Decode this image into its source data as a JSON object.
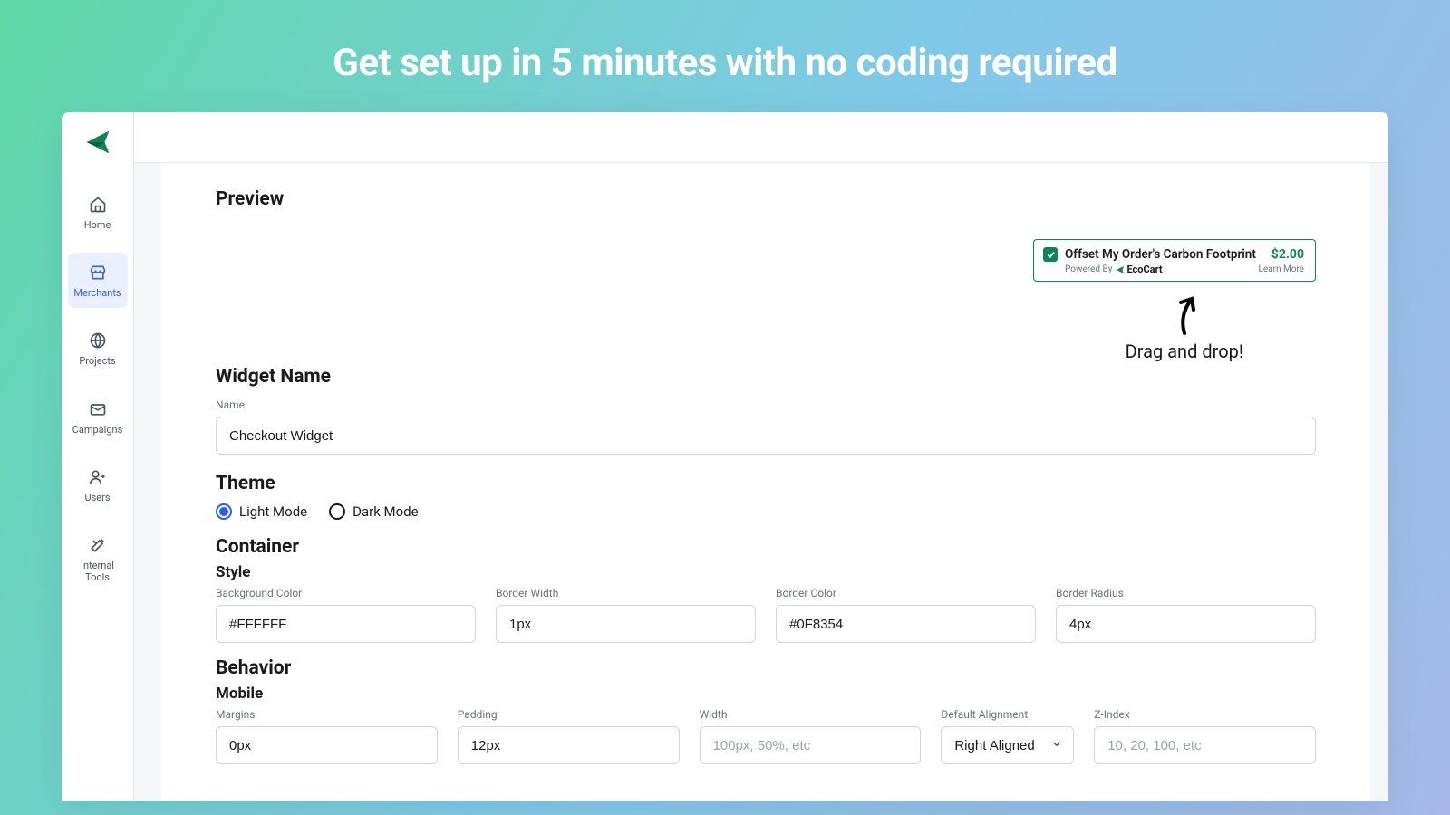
{
  "hero": {
    "title": "Get set up in 5 minutes with no coding required"
  },
  "sidebar": {
    "items": [
      {
        "label": "Home"
      },
      {
        "label": "Merchants"
      },
      {
        "label": "Projects"
      },
      {
        "label": "Campaigns"
      },
      {
        "label": "Users"
      },
      {
        "label": "Internal Tools"
      }
    ]
  },
  "content": {
    "preview_heading": "Preview",
    "widget": {
      "text": "Offset My Order's Carbon Footprint",
      "price": "$2.00",
      "powered_by": "Powered By",
      "brand": "EcoCart",
      "learn_more": "Learn More"
    },
    "drag_hint": "Drag and drop!",
    "widget_name": {
      "heading": "Widget Name",
      "label": "Name",
      "value": "Checkout Widget"
    },
    "theme": {
      "heading": "Theme",
      "light": "Light Mode",
      "dark": "Dark Mode"
    },
    "container": {
      "heading": "Container",
      "style_heading": "Style",
      "bg_color": {
        "label": "Background Color",
        "value": "#FFFFFF"
      },
      "border_width": {
        "label": "Border Width",
        "value": "1px"
      },
      "border_color": {
        "label": "Border Color",
        "value": "#0F8354"
      },
      "border_radius": {
        "label": "Border Radius",
        "value": "4px"
      }
    },
    "behavior": {
      "heading": "Behavior",
      "mobile_heading": "Mobile",
      "margins": {
        "label": "Margins",
        "value": "0px"
      },
      "padding": {
        "label": "Padding",
        "value": "12px"
      },
      "width": {
        "label": "Width",
        "placeholder": "100px, 50%, etc"
      },
      "alignment": {
        "label": "Default Alignment",
        "value": "Right Aligned"
      },
      "zindex": {
        "label": "Z-Index",
        "placeholder": "10, 20, 100, etc"
      }
    }
  }
}
